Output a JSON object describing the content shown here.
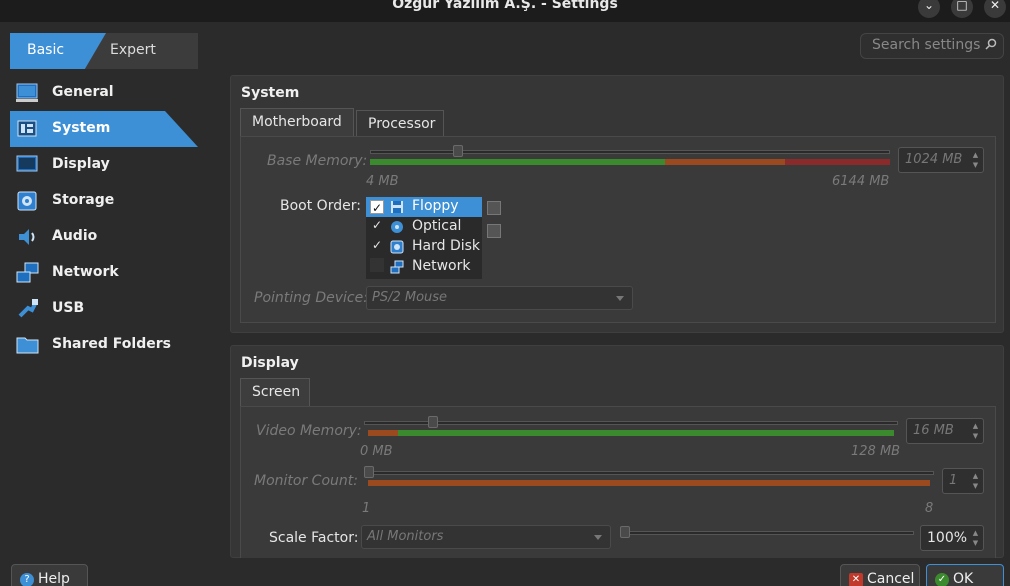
{
  "window": {
    "title": "Özgür Yazılım A.Ş. - Settings",
    "minimize": "⌄",
    "maximize": "□",
    "close": "✕"
  },
  "mode_tabs": {
    "basic": "Basic",
    "expert": "Expert"
  },
  "search": {
    "placeholder": "Search settings"
  },
  "nav": {
    "items": [
      {
        "label": "General",
        "icon": "general-icon"
      },
      {
        "label": "System",
        "icon": "system-icon",
        "active": true
      },
      {
        "label": "Display",
        "icon": "display-icon"
      },
      {
        "label": "Storage",
        "icon": "storage-icon"
      },
      {
        "label": "Audio",
        "icon": "audio-icon"
      },
      {
        "label": "Network",
        "icon": "network-icon"
      },
      {
        "label": "USB",
        "icon": "usb-icon"
      },
      {
        "label": "Shared Folders",
        "icon": "shared-folders-icon"
      }
    ]
  },
  "system": {
    "title": "System",
    "tabs": {
      "motherboard": "Motherboard",
      "processor": "Processor"
    },
    "base_memory": {
      "label": "Base Memory:",
      "value": "1024 MB",
      "min_label": "4 MB",
      "max_label": "6144 MB"
    },
    "boot_order": {
      "label": "Boot Order:",
      "items": [
        {
          "label": "Floppy",
          "checked": true,
          "selected": true,
          "check": "✓"
        },
        {
          "label": "Optical",
          "checked": true,
          "check": "✓"
        },
        {
          "label": "Hard Disk",
          "checked": true,
          "check": "✓"
        },
        {
          "label": "Network",
          "checked": false,
          "check": ""
        }
      ]
    },
    "pointing_device": {
      "label": "Pointing Device:",
      "value": "PS/2 Mouse"
    }
  },
  "display": {
    "title": "Display",
    "tabs": {
      "screen": "Screen"
    },
    "video_memory": {
      "label": "Video Memory:",
      "value": "16 MB",
      "min_label": "0 MB",
      "max_label": "128 MB"
    },
    "monitor_count": {
      "label": "Monitor Count:",
      "value": "1",
      "min_label": "1",
      "max_label": "8"
    },
    "scale_factor": {
      "label": "Scale Factor:",
      "monitor": "All Monitors",
      "value": "100%"
    }
  },
  "buttons": {
    "help": "Help",
    "cancel": "Cancel",
    "ok": "OK"
  },
  "colors": {
    "accent": "#3d8fd6",
    "band_green": "#3c8a2e",
    "band_orange": "#9a4a1e",
    "band_red": "#8a2a2a"
  }
}
